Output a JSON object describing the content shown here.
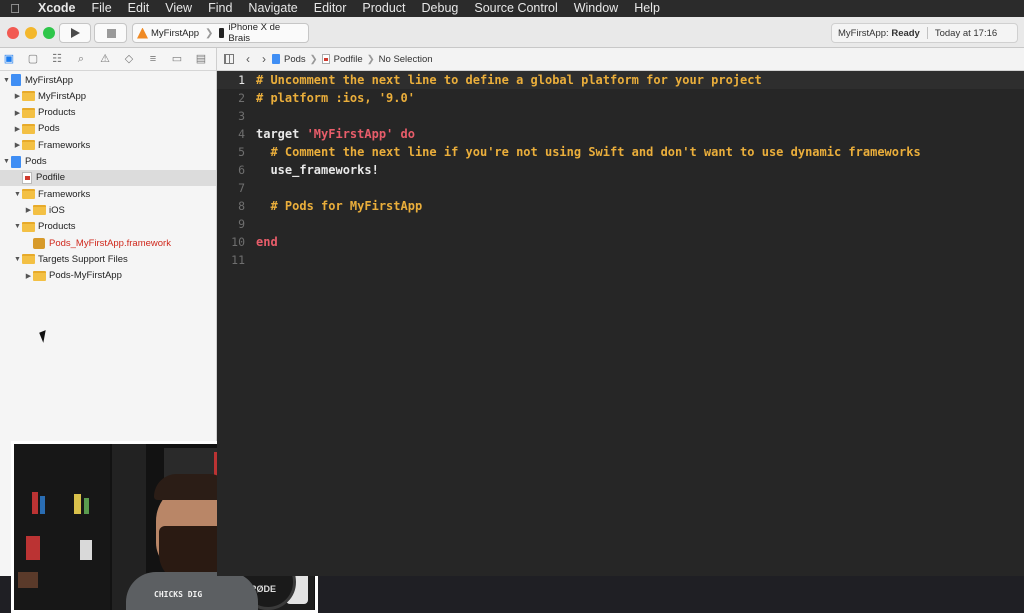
{
  "menubar": {
    "apple_icon": "apple-icon",
    "items": [
      "Xcode",
      "File",
      "Edit",
      "View",
      "Find",
      "Navigate",
      "Editor",
      "Product",
      "Debug",
      "Source Control",
      "Window",
      "Help"
    ]
  },
  "toolbar": {
    "scheme": "MyFirstApp",
    "device": "iPhone X de Brais",
    "status_app": "MyFirstApp:",
    "status_state": "Ready",
    "status_time": "Today at 17:16"
  },
  "navigator": {
    "rows": [
      {
        "label": "MyFirstApp",
        "icon": "project",
        "expanded": true,
        "indent": 0
      },
      {
        "label": "MyFirstApp",
        "icon": "folder",
        "expanded": false,
        "indent": 1
      },
      {
        "label": "Products",
        "icon": "folder",
        "expanded": false,
        "indent": 1
      },
      {
        "label": "Pods",
        "icon": "folder",
        "expanded": false,
        "indent": 1
      },
      {
        "label": "Frameworks",
        "icon": "folder",
        "expanded": false,
        "indent": 1
      },
      {
        "label": "Pods",
        "icon": "project",
        "expanded": true,
        "indent": 0
      },
      {
        "label": "Podfile",
        "icon": "ruby",
        "indent": 1,
        "selected": true
      },
      {
        "label": "Frameworks",
        "icon": "folder",
        "expanded": true,
        "indent": 1
      },
      {
        "label": "iOS",
        "icon": "folder",
        "expanded": false,
        "indent": 2
      },
      {
        "label": "Products",
        "icon": "folder",
        "expanded": true,
        "indent": 1
      },
      {
        "label": "Pods_MyFirstApp.framework",
        "icon": "framework",
        "indent": 2,
        "missing": true
      },
      {
        "label": "Targets Support Files",
        "icon": "folder",
        "expanded": true,
        "indent": 1
      },
      {
        "label": "Pods-MyFirstApp",
        "icon": "folder",
        "expanded": false,
        "indent": 2
      }
    ]
  },
  "jumpbar": {
    "project": "Pods",
    "file": "Podfile",
    "selection": "No Selection"
  },
  "code": {
    "lines": [
      {
        "n": "1",
        "t": "# Uncomment the next line to define a global platform for your project",
        "k": "cmt"
      },
      {
        "n": "2",
        "t": "# platform :ios, '9.0'",
        "k": "cmt"
      },
      {
        "n": "3",
        "t": "",
        "k": "kw"
      },
      {
        "n": "4",
        "k": "mixed",
        "parts": [
          {
            "t": "target ",
            "k": "kw"
          },
          {
            "t": "'MyFirstApp'",
            "k": "str"
          },
          {
            "t": " do",
            "k": "kwr"
          }
        ]
      },
      {
        "n": "5",
        "t": "  # Comment the next line if you're not using Swift and don't want to use dynamic frameworks",
        "k": "cmt"
      },
      {
        "n": "6",
        "t": "  use_frameworks!",
        "k": "kw"
      },
      {
        "n": "7",
        "t": "",
        "k": "kw"
      },
      {
        "n": "8",
        "t": "  # Pods for MyFirstApp",
        "k": "cmt"
      },
      {
        "n": "9",
        "t": "",
        "k": "kw"
      },
      {
        "n": "10",
        "t": "end",
        "k": "kwr"
      },
      {
        "n": "11",
        "t": "",
        "k": "kw"
      }
    ]
  },
  "webcam": {
    "shirt_text": "CHICKS DIG"
  }
}
